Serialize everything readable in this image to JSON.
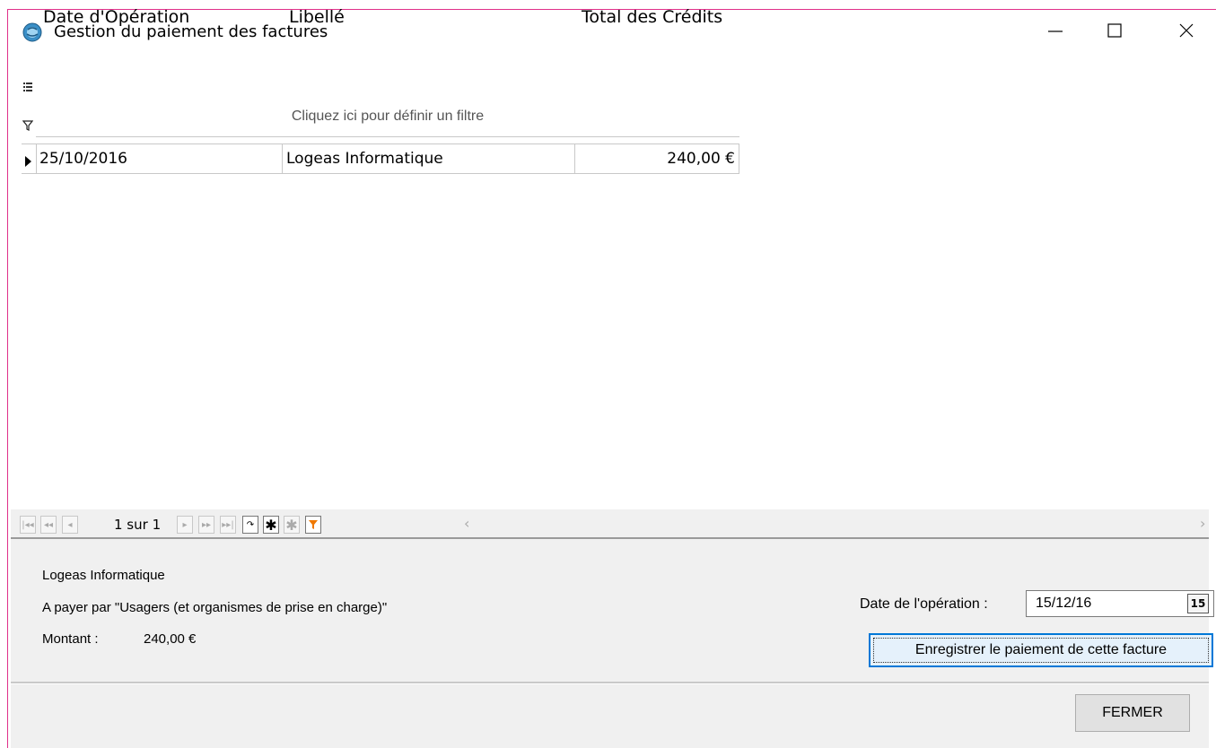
{
  "window": {
    "title": "Gestion du paiement des factures",
    "minimize_label": "—",
    "maximize_label": "☐",
    "close_label": "✕"
  },
  "grid": {
    "columns": [
      "Date d'Opération",
      "Libellé",
      "Total des Crédits"
    ],
    "filter_placeholder": "Cliquez ici pour définir un filtre",
    "rows": [
      {
        "date": "25/10/2016",
        "libelle": "Logeas Informatique",
        "total": "240,00 €"
      }
    ]
  },
  "navigator": {
    "page_label": "1 sur 1"
  },
  "details": {
    "name": "Logeas Informatique",
    "payer": "A payer par \"Usagers (et organismes de prise en charge)\"",
    "amount_label": "Montant :",
    "amount_value": "240,00 €"
  },
  "payment": {
    "date_label": "Date de l'opération :",
    "date_value": "15/12/16",
    "calendar_label": "15",
    "save_label": "Enregistrer le paiement de cette facture"
  },
  "footer": {
    "close_label": "FERMER"
  },
  "colors": {
    "window_border": "#e0308a",
    "accent": "#0078d7",
    "filter_icon": "#f07800"
  }
}
